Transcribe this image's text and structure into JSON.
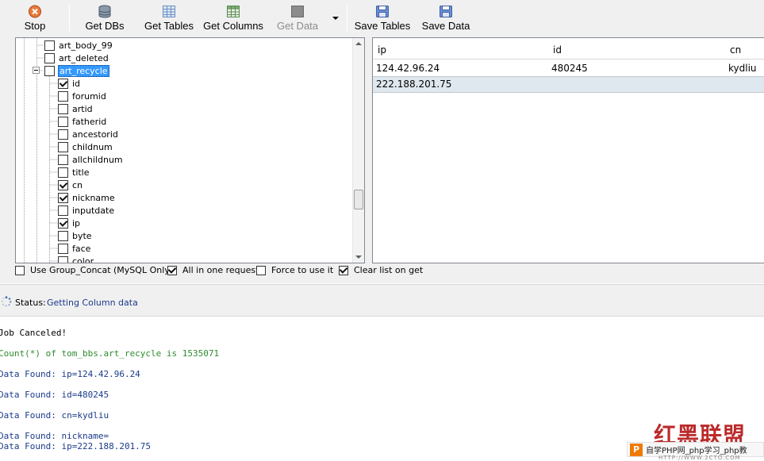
{
  "toolbar": {
    "buttons": [
      {
        "id": "stop",
        "label": "Stop",
        "icon": "stop-icon",
        "enabled": true
      },
      {
        "id": "get_dbs",
        "label": "Get DBs",
        "icon": "database-icon",
        "enabled": true
      },
      {
        "id": "get_tables",
        "label": "Get Tables",
        "icon": "table-icon",
        "enabled": true
      },
      {
        "id": "get_columns",
        "label": "Get Columns",
        "icon": "columns-icon",
        "enabled": true
      },
      {
        "id": "get_data",
        "label": "Get Data",
        "icon": "data-icon",
        "enabled": false
      },
      {
        "id": "save_tables",
        "label": "Save Tables",
        "icon": "save-icon",
        "enabled": true
      },
      {
        "id": "save_data",
        "label": "Save Data",
        "icon": "save-icon",
        "enabled": true
      }
    ],
    "dropdown_icon": "dropdown-arrow-icon"
  },
  "tree": {
    "nodes": [
      {
        "label": "art_body_99",
        "checked": false,
        "level": "table"
      },
      {
        "label": "art_deleted",
        "checked": false,
        "level": "table"
      },
      {
        "label": "art_recycle",
        "checked": false,
        "level": "table",
        "expanded": true,
        "selected": true
      },
      {
        "label": "id",
        "checked": true,
        "level": "column"
      },
      {
        "label": "forumid",
        "checked": false,
        "level": "column"
      },
      {
        "label": "artid",
        "checked": false,
        "level": "column"
      },
      {
        "label": "fatherid",
        "checked": false,
        "level": "column"
      },
      {
        "label": "ancestorid",
        "checked": false,
        "level": "column"
      },
      {
        "label": "childnum",
        "checked": false,
        "level": "column"
      },
      {
        "label": "allchildnum",
        "checked": false,
        "level": "column"
      },
      {
        "label": "title",
        "checked": false,
        "level": "column"
      },
      {
        "label": "cn",
        "checked": true,
        "level": "column"
      },
      {
        "label": "nickname",
        "checked": true,
        "level": "column"
      },
      {
        "label": "inputdate",
        "checked": false,
        "level": "column"
      },
      {
        "label": "ip",
        "checked": true,
        "level": "column"
      },
      {
        "label": "byte",
        "checked": false,
        "level": "column"
      },
      {
        "label": "face",
        "checked": false,
        "level": "column"
      },
      {
        "label": "color",
        "checked": false,
        "level": "column"
      }
    ]
  },
  "grid": {
    "columns": [
      "ip",
      "id",
      "cn"
    ],
    "rows": [
      [
        "124.42.96.24",
        "480245",
        "kydliu"
      ],
      [
        "222.188.201.75",
        "",
        ""
      ]
    ]
  },
  "options": [
    {
      "label": "Use Group_Concat (MySQL Only)",
      "checked": false
    },
    {
      "label": "All in one request.",
      "checked": true
    },
    {
      "label": "Force to use it",
      "checked": false
    },
    {
      "label": "Clear list on get",
      "checked": true
    }
  ],
  "status": {
    "label": "Status:",
    "value": "Getting Column data",
    "icon": "spinner-icon"
  },
  "log": [
    {
      "text": "Job Canceled!",
      "color": "#000000"
    },
    {
      "text": "Count(*) of tom_bbs.art_recycle is 1535071",
      "color": "#2e8b2e"
    },
    {
      "text": "Data Found: ip=124.42.96.24",
      "color": "#1a3a8a"
    },
    {
      "text": "Data Found: id=480245",
      "color": "#1a3a8a"
    },
    {
      "text": "Data Found: cn=kydliu",
      "color": "#1a3a8a"
    },
    {
      "text": "Data Found: nickname=",
      "color": "#1a3a8a"
    },
    {
      "text": "Data Found: ip=222.188.201.75",
      "color": "#1a3a8a"
    }
  ],
  "watermark": {
    "title": "红黑联盟",
    "logo": "P",
    "caption": "自学PHP网_php学习_php教",
    "url": "HTTP://WWW.2CTO.COM"
  },
  "colors": {
    "selection": "#3399ff",
    "alt_row": "#dfe8ee",
    "log_count": "#2e8b2e",
    "log_data": "#1a3a8a",
    "watermark": "#b82020"
  }
}
